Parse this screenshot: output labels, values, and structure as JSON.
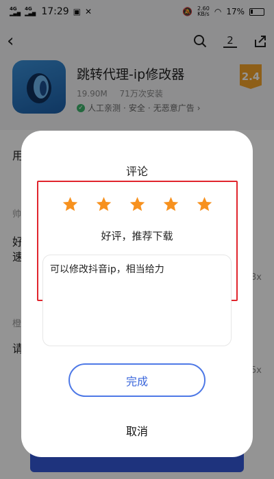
{
  "status_bar": {
    "signal1": "4G",
    "signal2": "4G",
    "time": "17:29",
    "net_speed": "2.60",
    "net_unit": "KB/s",
    "battery": "17%"
  },
  "nav": {
    "notification_count": "2"
  },
  "app": {
    "name": "跳转代理-ip修改器",
    "size": "19.90M",
    "installs": "71万次安装",
    "tags": [
      "人工亲测",
      "安全",
      "无恶意广告"
    ],
    "rating": "2.4"
  },
  "background_hints": {
    "section_label": "用",
    "row1_prefix": "帅",
    "row1_line1": "好",
    "row1_line2": "速",
    "row2_prefix": "橙",
    "row2_line1": "请",
    "count1": "3x",
    "count2": "5x"
  },
  "dialog": {
    "title": "评论",
    "star_count": 5,
    "rating_text": "好评，推荐下载",
    "comment": "可以修改抖音ip，相当给力",
    "done_label": "完成",
    "cancel_label": "取消"
  },
  "colors": {
    "star": "#f7911e",
    "highlight": "#e0242c",
    "accent": "#4d78e6"
  }
}
